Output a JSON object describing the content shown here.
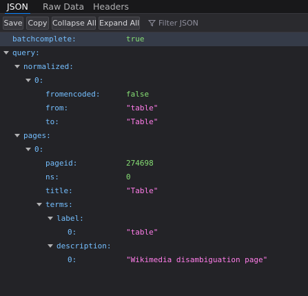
{
  "tabs": [
    {
      "label": "JSON",
      "selected": true
    },
    {
      "label": "Raw Data",
      "selected": false
    },
    {
      "label": "Headers",
      "selected": false
    }
  ],
  "toolbar": {
    "save_label": "Save",
    "copy_label": "Copy",
    "collapse_label": "Collapse All",
    "expand_label": "Expand All",
    "filter_placeholder": "Filter JSON"
  },
  "tree": {
    "batchcomplete": {
      "key": "batchcomplete:",
      "value": "true"
    },
    "query": {
      "key": "query:"
    },
    "normalized": {
      "key": "normalized:"
    },
    "normalized_0": {
      "key": "0:"
    },
    "fromencoded": {
      "key": "fromencoded:",
      "value": "false"
    },
    "from": {
      "key": "from:",
      "value": "\"table\""
    },
    "to": {
      "key": "to:",
      "value": "\"Table\""
    },
    "pages": {
      "key": "pages:"
    },
    "pages_0": {
      "key": "0:"
    },
    "pageid": {
      "key": "pageid:",
      "value": "274698"
    },
    "ns": {
      "key": "ns:",
      "value": "0"
    },
    "title": {
      "key": "title:",
      "value": "\"Table\""
    },
    "terms": {
      "key": "terms:"
    },
    "label": {
      "key": "label:"
    },
    "label_0": {
      "key": "0:",
      "value": "\"table\""
    },
    "description": {
      "key": "description:"
    },
    "description_0": {
      "key": "0:",
      "value": "\"Wikimedia disambiguation page\""
    }
  },
  "colors": {
    "background": "#232327",
    "key": "#75bfff",
    "string": "#ff7de9",
    "boolean_number": "#86de74",
    "tab_accent": "#0a84ff"
  }
}
